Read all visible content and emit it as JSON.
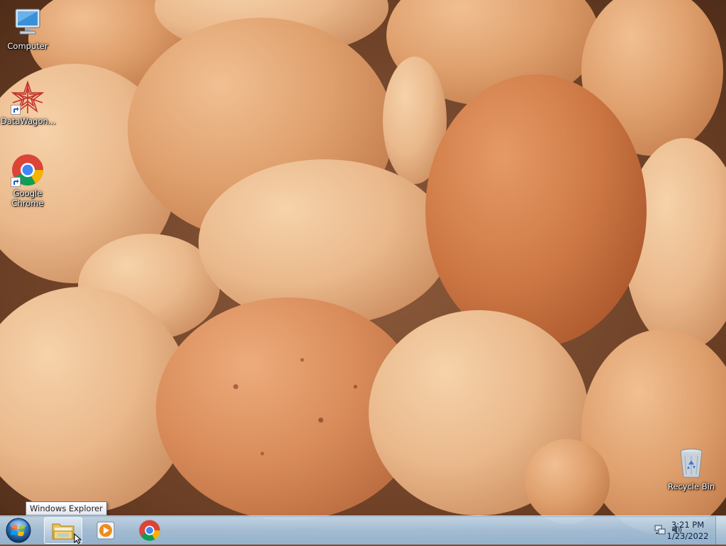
{
  "desktop": {
    "icons": [
      {
        "label": "Computer",
        "icon": "computer-icon"
      },
      {
        "label": "DataWagon...",
        "icon": "datawagon-icon"
      },
      {
        "label": "Google Chrome",
        "icon": "chrome-icon"
      },
      {
        "label": "Recycle Bin",
        "icon": "recycle-bin-icon"
      }
    ]
  },
  "tooltip": {
    "text": "Windows Explorer"
  },
  "taskbar": {
    "start": {
      "icon": "windows-start-orb-icon"
    },
    "pinned": [
      {
        "name": "Windows Explorer",
        "icon": "folder-icon",
        "active": true
      },
      {
        "name": "Windows Media Player",
        "icon": "media-player-icon",
        "active": false
      },
      {
        "name": "Google Chrome",
        "icon": "chrome-icon",
        "active": false
      }
    ],
    "tray": {
      "icons": [
        "network-icon",
        "volume-icon"
      ]
    },
    "clock": {
      "time": "3:21 PM",
      "date": "1/23/2022"
    }
  }
}
